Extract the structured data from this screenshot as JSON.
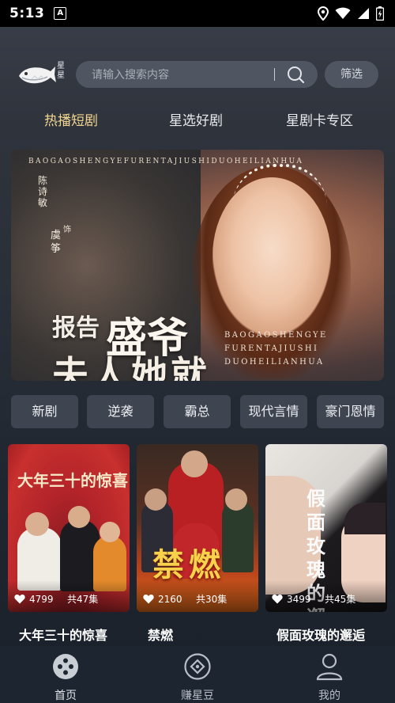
{
  "status_bar": {
    "time": "5:13",
    "notification_glyph": "A"
  },
  "header": {
    "logo_text": "星\n星",
    "search_placeholder": "请输入搜索内容",
    "filter_label": "筛选"
  },
  "tabs": [
    {
      "label": "热播短剧",
      "active": true
    },
    {
      "label": "星选好剧",
      "active": false
    },
    {
      "label": "星剧卡专区",
      "active": false
    }
  ],
  "banner": {
    "top_line": "BAOGAOSHENGYEFURENTAJIUSHIDUOHEILIANHUA",
    "actor": "陈诗敏",
    "as_text": "饰",
    "role": "虞筝",
    "title_part1": "报告",
    "title_part2": "盛爷",
    "title_part3": "夫人她就",
    "pinyin_lines": [
      "BAOGAOSHENGYE",
      "FURENTAJIUSHI",
      "DUOHEILIANHUA"
    ]
  },
  "genres": [
    "新剧",
    "逆袭",
    "霸总",
    "现代言情",
    "豪门恩情"
  ],
  "dramas": [
    {
      "title": "大年三十的惊喜",
      "poster_text": "大年三十的惊喜",
      "likes": "4799",
      "episodes": "共47集"
    },
    {
      "title": "禁燃",
      "poster_text": "禁燃",
      "likes": "2160",
      "episodes": "共30集"
    },
    {
      "title": "假面玫瑰的邂逅",
      "poster_text": "假面玫瑰的邂逅",
      "likes": "3499",
      "episodes": "共45集"
    }
  ],
  "bottom_nav": [
    {
      "label": "首页",
      "icon": "home-dots-icon",
      "active": true
    },
    {
      "label": "赚星豆",
      "icon": "diamond-coin-icon",
      "active": false
    },
    {
      "label": "我的",
      "icon": "person-icon",
      "active": false
    }
  ],
  "colors": {
    "active_tab": "#f3d690",
    "accent_red": "#c2272d"
  }
}
